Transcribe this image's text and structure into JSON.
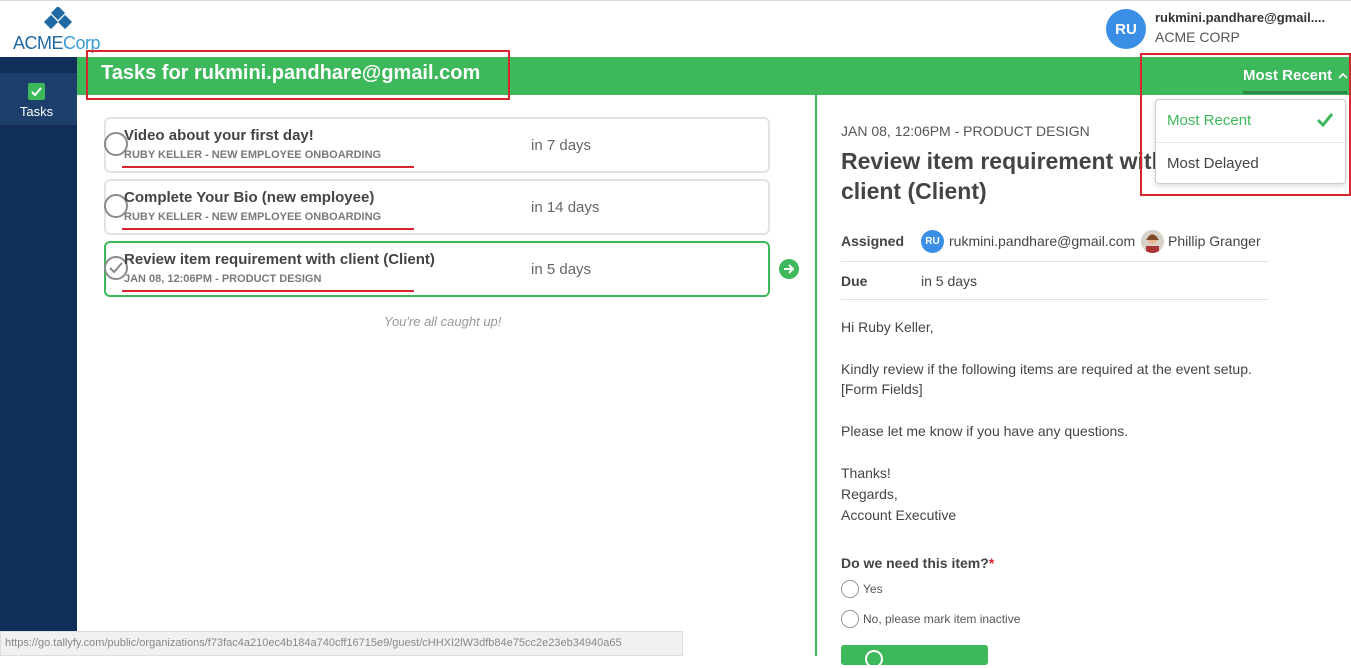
{
  "brand": {
    "name_part1": "ACME",
    "name_part2": "Corp"
  },
  "user": {
    "initials": "RU",
    "email": "rukmini.pandhare@gmail....",
    "org": "ACME CORP"
  },
  "sidebar": {
    "items": [
      {
        "label": "Tasks",
        "icon": "checkbox-icon"
      }
    ]
  },
  "header": {
    "title": "Tasks for rukmini.pandhare@gmail.com",
    "sort_label": "Most Recent"
  },
  "sort_menu": {
    "options": [
      "Most Recent",
      "Most Delayed"
    ],
    "selected": "Most Recent"
  },
  "tasks": [
    {
      "name": "Video about your first day!",
      "sub": "RUBY KELLER - NEW EMPLOYEE ONBOARDING",
      "due": "in 7 days",
      "completed": false
    },
    {
      "name": "Complete Your Bio (new employee)",
      "sub": "RUBY KELLER - NEW EMPLOYEE ONBOARDING",
      "due": "in 14 days",
      "completed": false
    },
    {
      "name": "Review item requirement with client (Client)",
      "sub": "JAN 08, 12:06PM - PRODUCT DESIGN",
      "due": "in 5 days",
      "completed": true
    }
  ],
  "caught_up": "You're all caught up!",
  "detail": {
    "meta": "JAN 08, 12:06PM - PRODUCT DESIGN",
    "title": "Review item requirement with client (Client)",
    "assigned_label": "Assigned",
    "assignee_initials": "RU",
    "assignee_email": "rukmini.pandhare@gmail.com",
    "assignee2_name": "Phillip Granger",
    "due_label": "Due",
    "due_value": "in 5 days",
    "body": {
      "greeting": "Hi Ruby Keller,",
      "line1": "Kindly review if the following items are required at the event setup.",
      "line2": "[Form Fields]",
      "line3": "Please let me know if you have any questions.",
      "line4": "Thanks!",
      "line5": "Regards,",
      "line6": "Account Executive"
    },
    "question": "Do we need this item?",
    "question_required": "*",
    "options": [
      "Yes",
      "No, please mark item inactive"
    ]
  },
  "status_url": "https://go.tallyfy.com/public/organizations/f73fac4a210ec4b184a740cff16715e9/guest/cHHXI2lW3dfb84e75cc2e23eb34940a65",
  "colors": {
    "accent_green": "#3db85b",
    "sidebar_navy": "#102e57",
    "annotation_red": "#d9262e",
    "avatar_blue": "#3a8ee6"
  }
}
